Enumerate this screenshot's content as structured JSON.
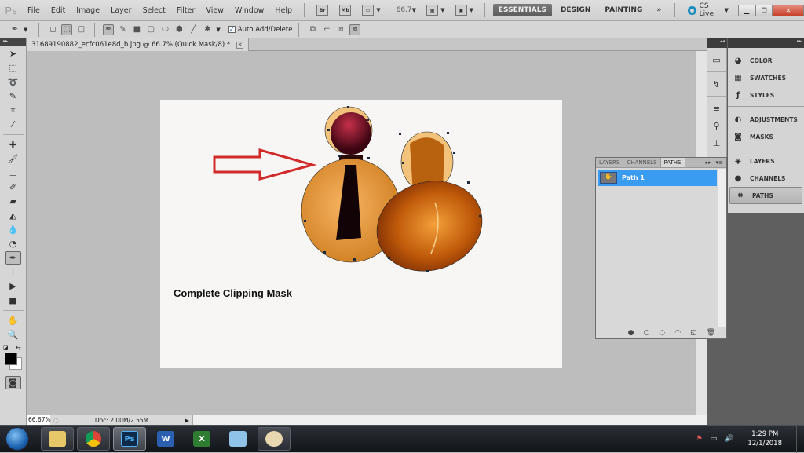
{
  "app": {
    "logo": "Ps",
    "menu": [
      "File",
      "Edit",
      "Image",
      "Layer",
      "Select",
      "Filter",
      "View",
      "Window",
      "Help"
    ],
    "bridge_button": "Br",
    "minibridge_button": "Mb",
    "zoom_value": "66.7",
    "workspaces": [
      "ESSENTIALS",
      "DESIGN",
      "PAINTING"
    ],
    "active_workspace": "ESSENTIALS",
    "more_workspaces": "»",
    "cs_live": "CS Live"
  },
  "options": {
    "auto_add_delete_label": "Auto Add/Delete",
    "auto_add_delete_checked": true
  },
  "document": {
    "tab_title": "31689190882_ecfc061e8d_b.jpg @ 66.7% (Quick Mask/8) *",
    "caption": "Complete Clipping Mask",
    "annotation_color": "#d12a2a"
  },
  "status": {
    "zoom": "66.67%",
    "doc_size": "Doc: 2.00M/2.55M"
  },
  "panels": {
    "dock_items": [
      {
        "label": "COLOR",
        "icon": "color-icon"
      },
      {
        "label": "SWATCHES",
        "icon": "swatches-icon"
      },
      {
        "label": "STYLES",
        "icon": "styles-icon"
      },
      {
        "label": "ADJUSTMENTS",
        "icon": "adjustments-icon"
      },
      {
        "label": "MASKS",
        "icon": "masks-icon"
      },
      {
        "label": "LAYERS",
        "icon": "layers-icon"
      },
      {
        "label": "CHANNELS",
        "icon": "channels-icon"
      },
      {
        "label": "PATHS",
        "icon": "paths-icon"
      }
    ],
    "active_dock_item": "PATHS",
    "floating": {
      "tabs": [
        "LAYERS",
        "CHANNELS",
        "PATHS"
      ],
      "active_tab": "PATHS",
      "paths": [
        {
          "name": "Path 1",
          "selected": true
        }
      ],
      "selection_color": "#3a9cf0"
    }
  },
  "taskbar": {
    "apps": [
      "windows-explorer",
      "chrome",
      "photoshop",
      "word",
      "excel",
      "notepad",
      "paint"
    ],
    "active_app": "photoshop",
    "ps_label": "Ps",
    "time": "1:29 PM",
    "date": "12/1/2018"
  }
}
